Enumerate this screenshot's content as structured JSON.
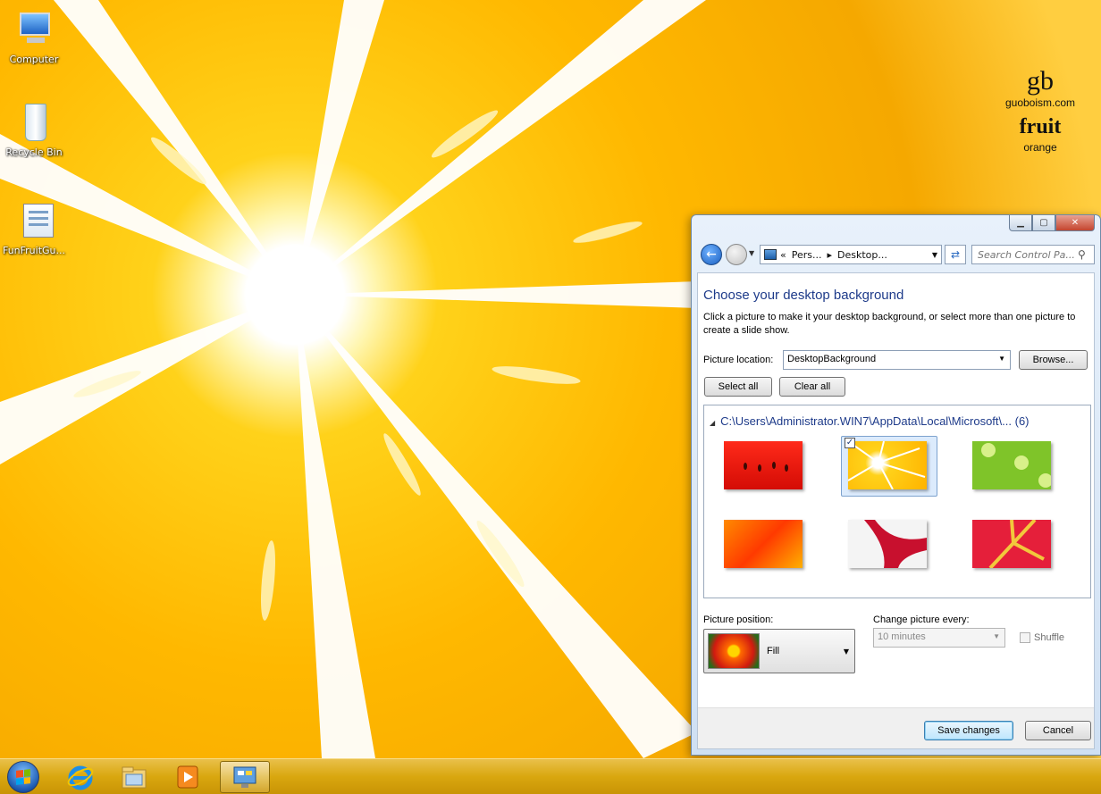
{
  "desktop": {
    "icons": [
      {
        "label": "Computer",
        "icon": "computer-icon"
      },
      {
        "label": "Recycle Bin",
        "icon": "recycle-bin-icon"
      },
      {
        "label": "FunFruitGu...",
        "icon": "file-icon"
      }
    ],
    "brand": {
      "logo_gb": "gb",
      "site": "guoboism.com",
      "logo_fruit": "fruit",
      "name": "orange"
    }
  },
  "window": {
    "caption_buttons": {
      "minimize": "▁",
      "maximize": "▢",
      "close": "✕"
    },
    "nav": {
      "back": "←",
      "address_prefix": "«",
      "breadcrumb": [
        "Pers...",
        "Desktop..."
      ],
      "search_placeholder": "Search Control Pa..."
    },
    "heading": "Choose your desktop background",
    "description": "Click a picture to make it your desktop background, or select more than one picture to create a slide show.",
    "picture_location": {
      "label": "Picture location:",
      "value": "DesktopBackground",
      "browse": "Browse..."
    },
    "select_all": "Select all",
    "clear_all": "Clear all",
    "gallery": {
      "folder_path": "C:\\Users\\Administrator.WIN7\\AppData\\Local\\Microsoft\\...",
      "count": "(6)",
      "thumbnails": [
        {
          "name": "watermelon",
          "selected": false
        },
        {
          "name": "orange",
          "selected": true
        },
        {
          "name": "kiwi",
          "selected": false
        },
        {
          "name": "papaya",
          "selected": false
        },
        {
          "name": "dragonfruit",
          "selected": false
        },
        {
          "name": "strawberry",
          "selected": false
        }
      ]
    },
    "picture_position": {
      "label": "Picture position:",
      "value": "Fill"
    },
    "change_picture": {
      "label": "Change picture every:",
      "value": "10 minutes",
      "shuffle": "Shuffle"
    },
    "save_button": "Save changes",
    "cancel_button": "Cancel"
  },
  "colors": {
    "accent": "#1e3b8a",
    "wallpaper": "#ffb800",
    "taskbar": "#d9a70f"
  }
}
